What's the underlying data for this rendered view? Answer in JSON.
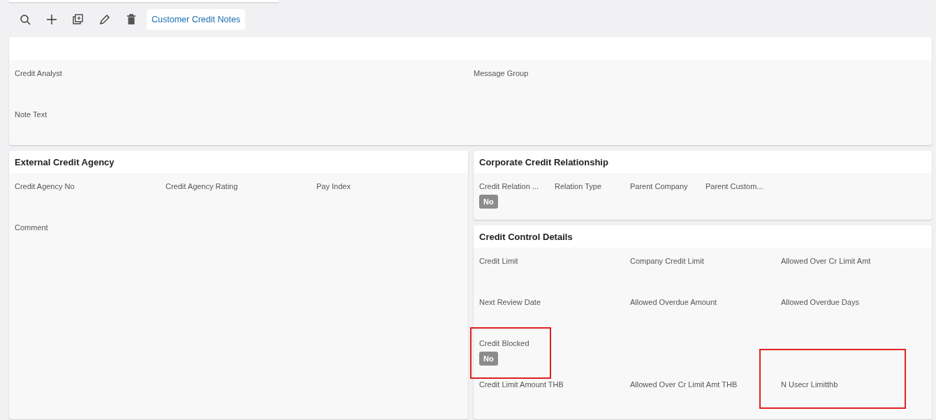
{
  "toolbar": {
    "buttons": [
      {
        "kind": "search"
      },
      {
        "kind": "add"
      },
      {
        "kind": "duplicate"
      },
      {
        "kind": "edit"
      },
      {
        "kind": "delete"
      }
    ],
    "link": "Customer Credit Notes"
  },
  "top_card": {
    "rows": [
      [
        {
          "label": "Credit Analyst"
        },
        {
          "label": "Message Group"
        }
      ],
      [
        {
          "label": "Note Text"
        }
      ]
    ]
  },
  "left_card": {
    "title": "External Credit Agency",
    "rows": [
      [
        {
          "label": "Credit Agency No"
        },
        {
          "label": "Credit Agency Rating"
        },
        {
          "label": "Pay Index"
        }
      ],
      [
        {
          "label": "Comment"
        }
      ]
    ]
  },
  "relationship_card": {
    "title": "Corporate Credit Relationship",
    "rows": [
      [
        {
          "label": "Credit Relation ...",
          "value": "No"
        },
        {
          "label": "Relation Type"
        },
        {
          "label": "Parent Company"
        },
        {
          "label": "Parent Custom..."
        }
      ]
    ]
  },
  "control_card": {
    "title": "Credit Control Details",
    "rows": [
      [
        {
          "label": "Credit Limit"
        },
        {
          "label": "Company Credit Limit"
        },
        {
          "label": "Allowed Over Cr Limit Amt"
        }
      ],
      [
        {
          "label": "Next Review Date"
        },
        {
          "label": "Allowed Overdue Amount"
        },
        {
          "label": "Allowed Overdue Days"
        }
      ],
      [
        {
          "label": "Credit Blocked",
          "value": "No",
          "highlighted": true
        }
      ],
      [
        {
          "label": "Credit Limit Amount THB"
        },
        {
          "label": "Allowed Over Cr Limit Amt THB"
        },
        {
          "label": "N Usecr Limitthb",
          "highlighted": true
        }
      ]
    ]
  }
}
